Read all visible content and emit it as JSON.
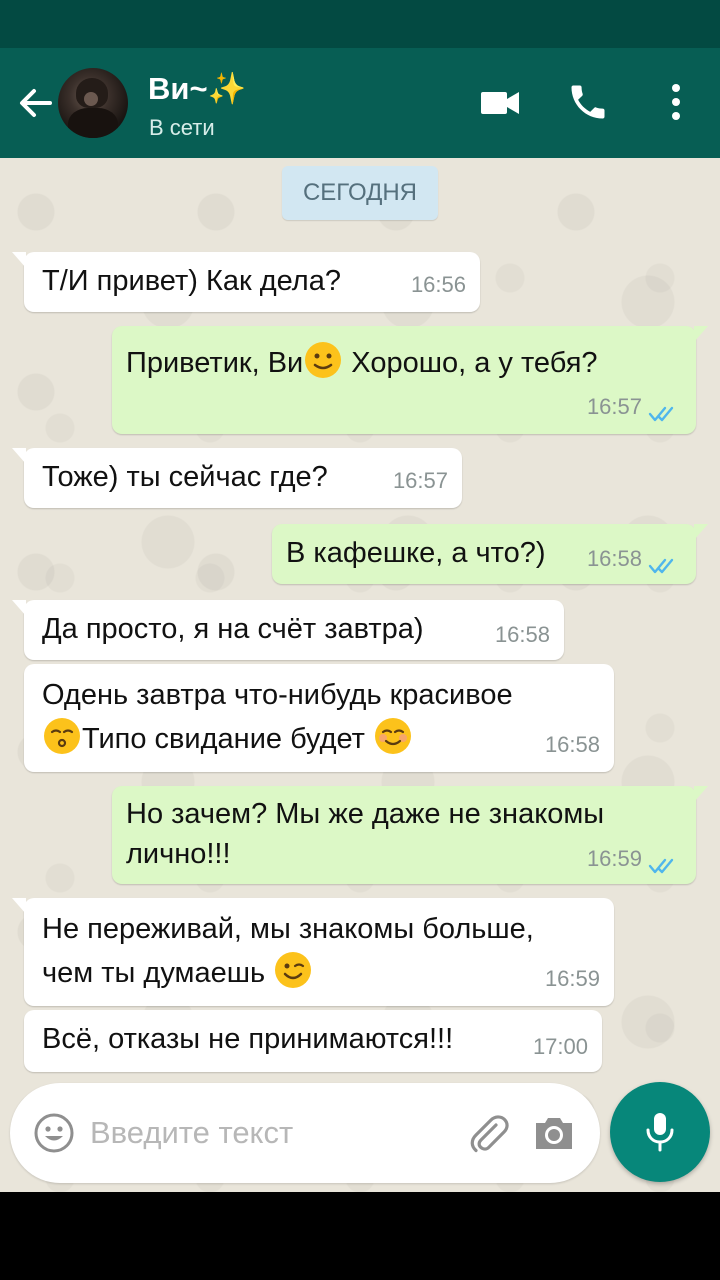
{
  "header": {
    "contact_name": "Ви~✨",
    "status": "В сети",
    "icons": [
      "back-arrow-icon",
      "video-call-icon",
      "phone-icon",
      "more-vert-icon"
    ]
  },
  "chat": {
    "date_label": "СЕГОДНЯ",
    "messages": [
      {
        "dir": "in",
        "text": "Т/И привет) Как дела?",
        "time": "16:56"
      },
      {
        "dir": "out",
        "text_before": "Приветик, Ви",
        "emoji": "slightly-smiling-face",
        "text_after": " Хорошо, а у тебя?",
        "time": "16:57",
        "read": true
      },
      {
        "dir": "in",
        "text": "Тоже) ты сейчас где?",
        "time": "16:57"
      },
      {
        "dir": "out",
        "text": "В кафешке, а что?)",
        "time": "16:58",
        "read": true
      },
      {
        "dir": "in",
        "text": "Да просто, я на счёт завтра)",
        "time": "16:58"
      },
      {
        "dir": "in",
        "line1": "Одень завтра что-нибудь красивое",
        "emoji1": "kissing-face",
        "line2": "Типо свидание будет ",
        "emoji2": "smiling-face",
        "time": "16:58"
      },
      {
        "dir": "out",
        "line1": "Но зачем? Мы же даже не знакомы",
        "line2": "лично!!!",
        "time": "16:59",
        "read": true
      },
      {
        "dir": "in",
        "line1": "Не переживай, мы знакомы больше,",
        "line2": "чем ты думаешь ",
        "emoji": "winking-face",
        "time": "16:59"
      },
      {
        "dir": "in",
        "text": "Всё, отказы не принимаются!!!",
        "time": "17:00"
      }
    ]
  },
  "input": {
    "placeholder": "Введите текст",
    "icons": [
      "emoji-icon",
      "attach-icon",
      "camera-icon",
      "mic-icon"
    ]
  },
  "colors": {
    "header": "#075e54",
    "status_bar": "#034a42",
    "bubble_out": "#dcf8c6",
    "bubble_in": "#ffffff",
    "read_ticks": "#4fb6ec",
    "mic_button": "#07877a"
  }
}
